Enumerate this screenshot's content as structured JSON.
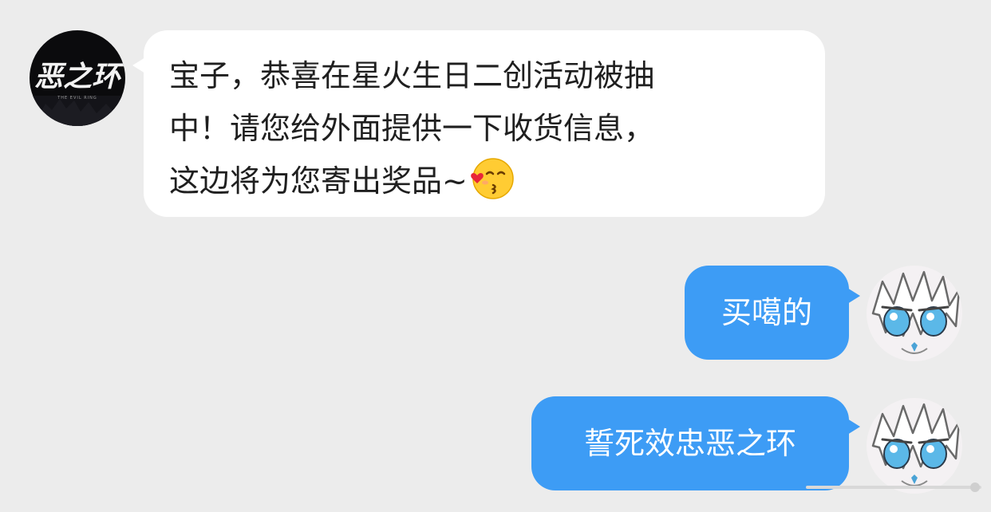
{
  "messages": [
    {
      "direction": "incoming",
      "sender_avatar": "evil-ring-logo-avatar",
      "lines": [
        "宝子，恭喜在星火生日二创活动被抽",
        "中！请您给外面提供一下收货信息，",
        "这边将为您寄出奖品~"
      ],
      "trailing_emoji": "kissing-face-heart-emoji"
    },
    {
      "direction": "outgoing",
      "sender_avatar": "anime-character-avatar",
      "text": "买噶的"
    },
    {
      "direction": "outgoing",
      "sender_avatar": "anime-character-avatar",
      "text": "誓死效忠恶之环"
    }
  ],
  "logo": {
    "text": "恶之环",
    "subtext": "THE EVIL RING"
  },
  "colors": {
    "background": "#ececec",
    "incoming_bubble": "#ffffff",
    "outgoing_bubble": "#3d9cf5",
    "outgoing_text": "#ffffff"
  }
}
